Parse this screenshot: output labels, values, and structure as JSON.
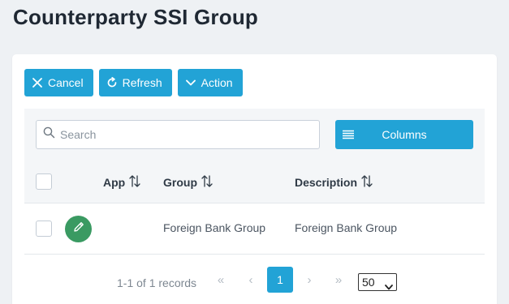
{
  "page": {
    "title": "Counterparty SSI Group"
  },
  "toolbar": {
    "cancel_label": "Cancel",
    "refresh_label": "Refresh",
    "action_label": "Action"
  },
  "search": {
    "placeholder": "Search",
    "value": ""
  },
  "columns_button": {
    "label": "Columns"
  },
  "table": {
    "headers": [
      "App",
      "Group",
      "Description"
    ],
    "rows": [
      {
        "app": "",
        "group": "Foreign Bank Group",
        "description": "Foreign Bank Group"
      }
    ]
  },
  "pagination": {
    "records_text": "1-1 of 1 records",
    "first": "«",
    "prev": "‹",
    "current_page": "1",
    "next": "›",
    "last": "»",
    "page_size": "50"
  },
  "colors": {
    "accent": "#22a3d6",
    "edit": "#3a9a62",
    "background": "#eef1f4"
  },
  "icons": {
    "cancel": "close-icon",
    "refresh": "refresh-icon",
    "action": "chevron-down-icon",
    "search": "search-icon",
    "columns": "list-icon",
    "sort": "sort-icon",
    "edit": "pencil-icon"
  }
}
